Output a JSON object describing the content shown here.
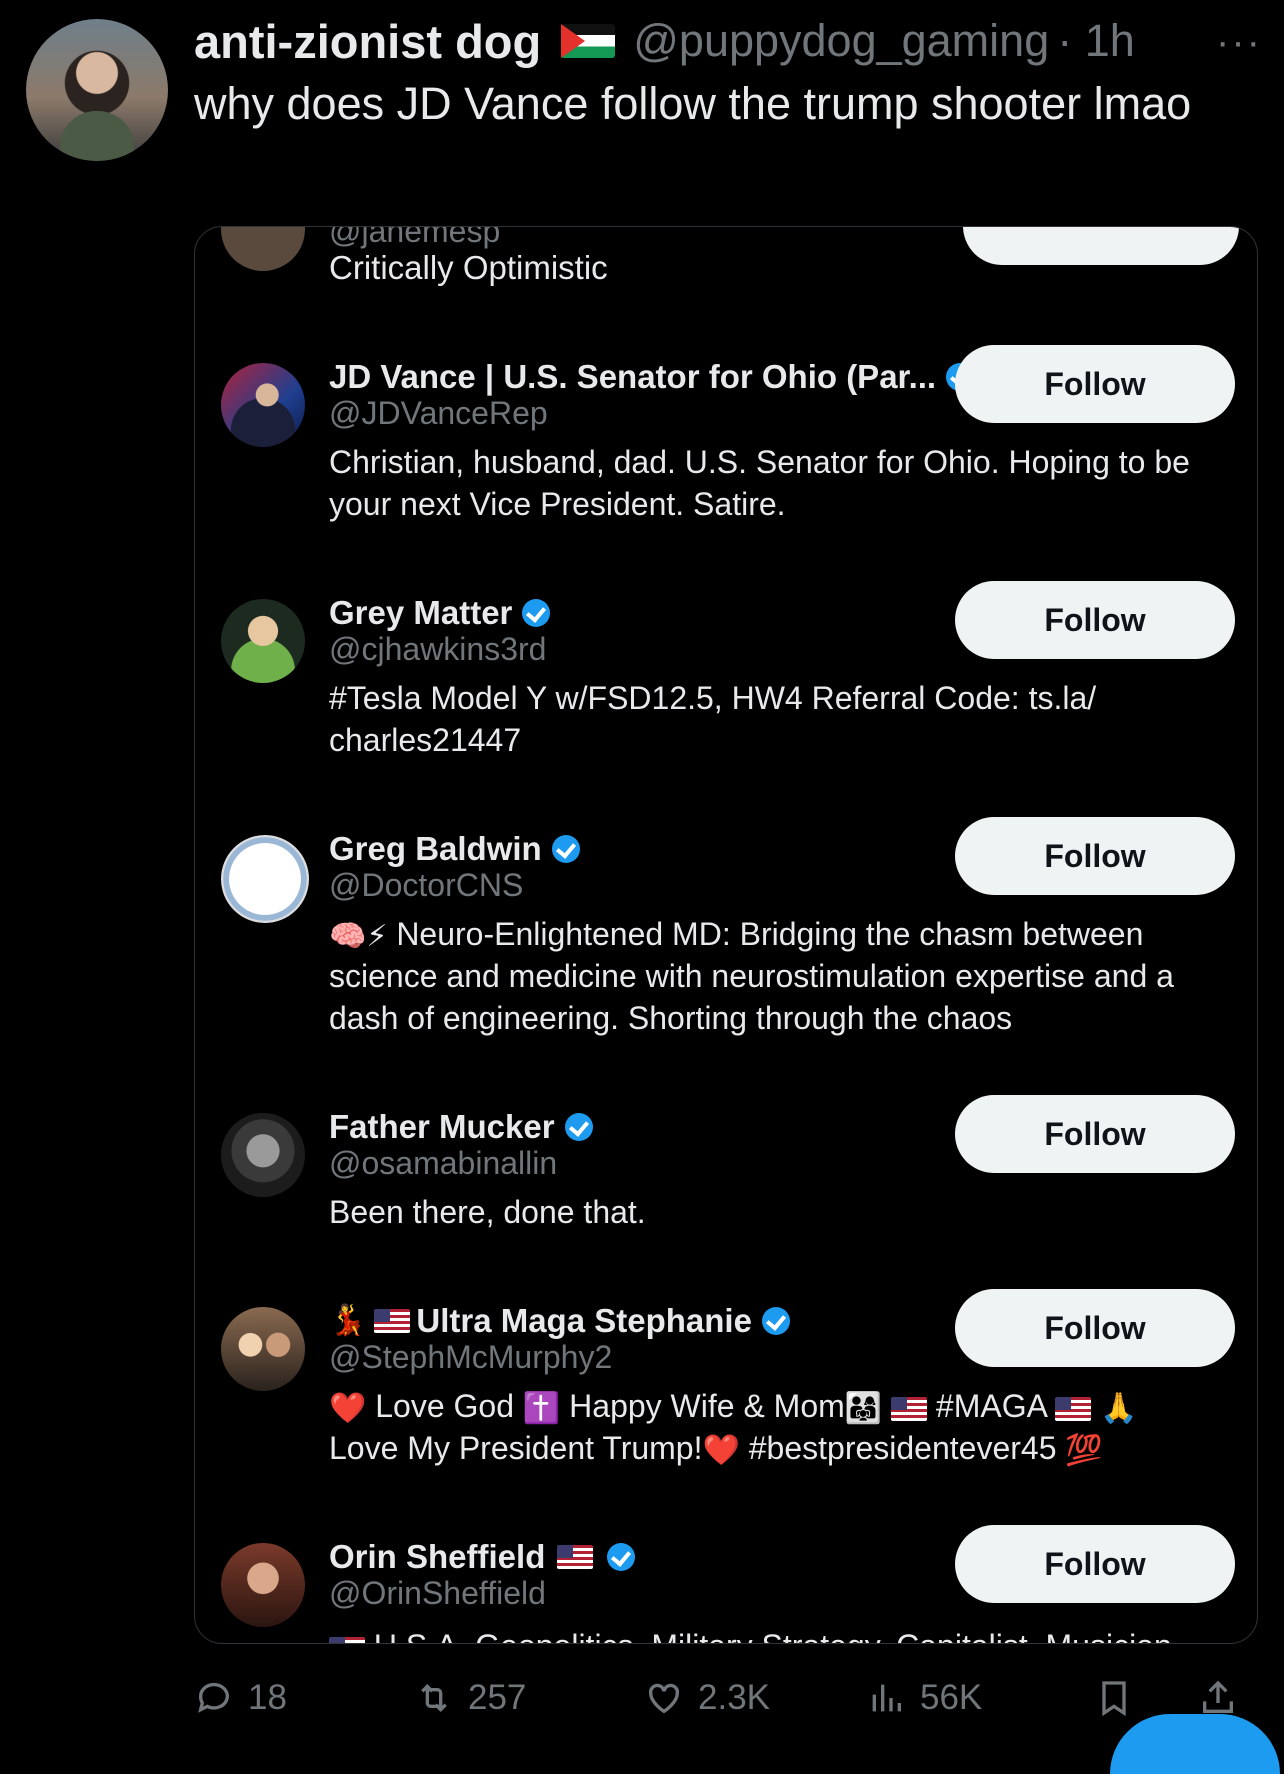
{
  "tweet": {
    "author_name": "anti-zionist dog",
    "handle": "@puppydog_gaming",
    "time": "· 1h",
    "more": "···",
    "text": "why does JD Vance follow the trump shooter lmao"
  },
  "card": {
    "clipped_top": {
      "handle": "@janemesp",
      "bio": "Critically Optimistic"
    },
    "users": [
      {
        "name": "JD Vance | U.S. Senator for Ohio (Par...",
        "handle": "@JDVanceRep",
        "bio": "Christian, husband, dad. U.S. Senator for Ohio. Hoping to be your next Vice President. Satire.",
        "follow_label": "Follow",
        "verified": true
      },
      {
        "name": "Grey Matter",
        "handle": "@cjhawkins3rd",
        "bio": "#Tesla Model Y w/FSD12.5, HW4 Referral Code: ts.la/ charles21447",
        "follow_label": "Follow",
        "verified": true
      },
      {
        "name": "Greg Baldwin",
        "handle": "@DoctorCNS",
        "bio_emoji": "🧠⚡",
        "bio": "Neuro-Enlightened MD: Bridging the chasm between science and medicine with neurostimulation expertise and a dash of engineering. Shorting through the chaos",
        "follow_label": "Follow",
        "verified": true
      },
      {
        "name": "Father Mucker",
        "handle": "@osamabinallin",
        "bio": "Been there, done that.",
        "follow_label": "Follow",
        "verified": true
      },
      {
        "name": "Ultra Maga Stephanie",
        "name_emoji": "💃",
        "handle": "@StephMcMurphy2",
        "bio_parts": [
          "Love God",
          "Happy Wife & Mom",
          "#MAGA",
          "Love My President Trump!",
          "#bestpresidentever45"
        ],
        "bio_emojis": [
          "❤️",
          "✝️",
          "👨‍👩‍👧",
          "🙏",
          "❤️",
          "💯"
        ],
        "follow_label": "Follow",
        "verified": true
      },
      {
        "name": "Orin Sheffield",
        "handle": "@OrinSheffield",
        "bio": "U.S.A. Geopolitics. Military Strategy. Capitalist. Musician",
        "follow_label": "Follow",
        "verified": true
      }
    ]
  },
  "actions": {
    "replies": "18",
    "reposts": "257",
    "likes": "2.3K",
    "views": "56K"
  },
  "colors": {
    "accent": "#1d9bf0",
    "muted": "#71767b",
    "button_bg": "#eff3f4"
  }
}
